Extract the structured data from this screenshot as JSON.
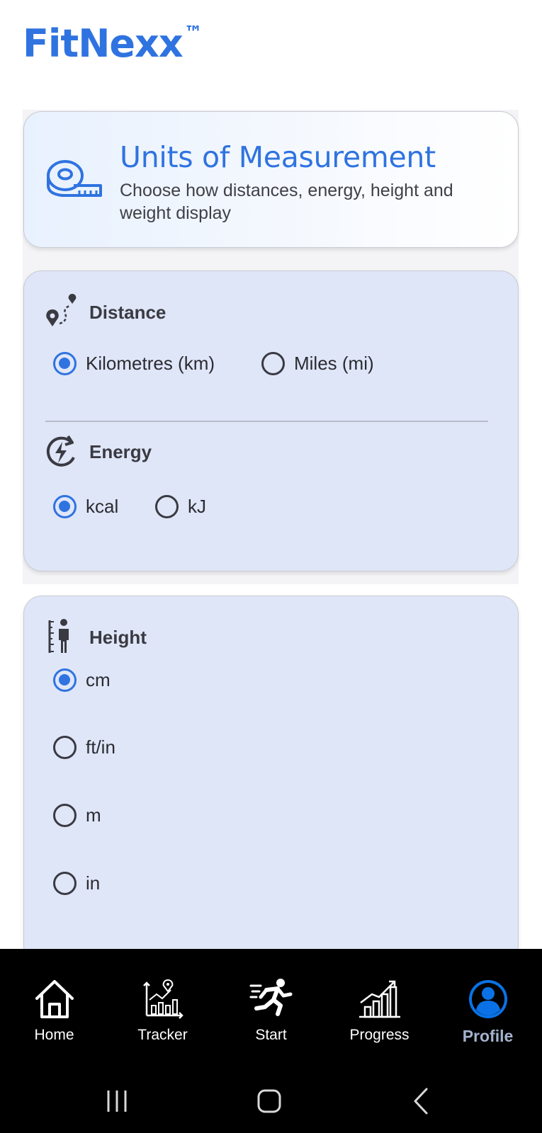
{
  "app": {
    "brand": "FitNexx",
    "brand_mark": "™"
  },
  "header_card": {
    "icon": "measuring-tape-icon",
    "title": "Units of Measurement",
    "subtitle": "Choose how distances, energy, height and weight display"
  },
  "distance": {
    "icon": "route-pin-icon",
    "title": "Distance",
    "options": [
      {
        "label": "Kilometres (km)",
        "selected": true
      },
      {
        "label": "Miles (mi)",
        "selected": false
      }
    ]
  },
  "energy": {
    "icon": "energy-cycle-icon",
    "title": "Energy",
    "options": [
      {
        "label": "kcal",
        "selected": true
      },
      {
        "label": "kJ",
        "selected": false
      }
    ]
  },
  "height": {
    "icon": "height-ruler-person-icon",
    "title": "Height",
    "options": [
      {
        "label": "cm",
        "selected": true
      },
      {
        "label": "ft/in",
        "selected": false
      },
      {
        "label": "m",
        "selected": false
      },
      {
        "label": "in",
        "selected": false
      }
    ]
  },
  "nav": {
    "items": [
      {
        "label": "Home",
        "icon": "home-icon",
        "active": false
      },
      {
        "label": "Tracker",
        "icon": "tracker-chart-icon",
        "active": false
      },
      {
        "label": "Start",
        "icon": "running-person-icon",
        "active": false
      },
      {
        "label": "Progress",
        "icon": "bar-chart-icon",
        "active": false
      },
      {
        "label": "Profile",
        "icon": "profile-icon",
        "active": true
      }
    ]
  },
  "system_nav": {
    "buttons": [
      "recent-apps-icon",
      "home-button-icon",
      "back-icon"
    ]
  },
  "colors": {
    "accent": "#2f73e0",
    "card_bg": "#dfe6f8",
    "navbar_bg": "#000000",
    "active_nav_label": "#a4b2cd"
  }
}
